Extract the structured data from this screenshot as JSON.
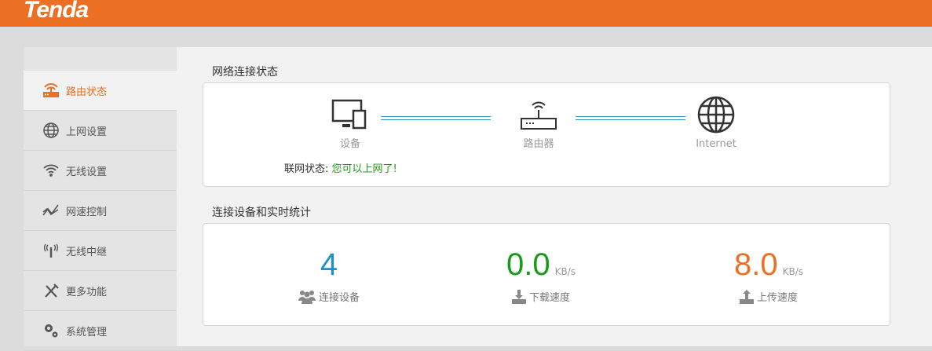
{
  "header": {
    "logo": "Tenda"
  },
  "sidebar": {
    "items": [
      {
        "label": "路由状态",
        "icon": "router-icon",
        "active": true
      },
      {
        "label": "上网设置",
        "icon": "globe-icon"
      },
      {
        "label": "无线设置",
        "icon": "wifi-icon"
      },
      {
        "label": "网速控制",
        "icon": "speed-chart-icon"
      },
      {
        "label": "无线中继",
        "icon": "antenna-icon"
      },
      {
        "label": "更多功能",
        "icon": "tools-icon"
      },
      {
        "label": "系统管理",
        "icon": "gears-icon"
      }
    ]
  },
  "network": {
    "title": "网络连接状态",
    "device": "设备",
    "router": "路由器",
    "internet": "Internet",
    "status_label": "联网状态:",
    "status_value": "您可以上网了!"
  },
  "stats": {
    "title": "连接设备和实时统计",
    "devices": {
      "value": "4",
      "label": "连接设备"
    },
    "download": {
      "value": "0.0",
      "unit": "KB/s",
      "label": "下载速度"
    },
    "upload": {
      "value": "8.0",
      "unit": "KB/s",
      "label": "上传速度"
    }
  },
  "colors": {
    "brand": "#ec7023",
    "blue": "#1e90c8",
    "green": "#1a9a1a",
    "orange": "#ec7023"
  }
}
